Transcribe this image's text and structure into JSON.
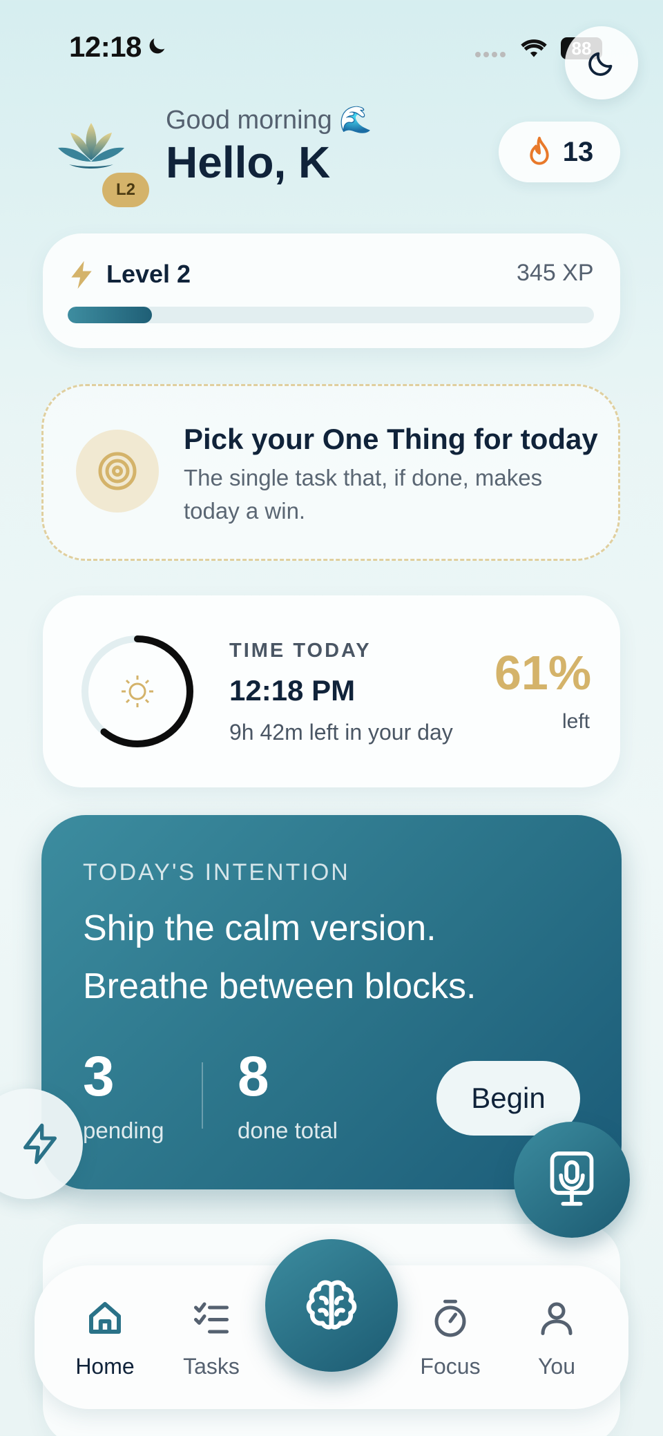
{
  "status_bar": {
    "time": "12:18",
    "battery": "88"
  },
  "header": {
    "greeting": "Good morning 🌊",
    "title": "Hello, K",
    "level_badge": "L2",
    "streak_count": "13"
  },
  "level_card": {
    "title": "Level 2",
    "xp": "345 XP",
    "progress_fraction": 0.16
  },
  "one_thing": {
    "title": "Pick your One Thing for today",
    "subtitle": "The single task that, if done, makes today a win."
  },
  "time_card": {
    "label": "TIME TODAY",
    "time": "12:18 PM",
    "remaining": "9h 42m left in your day",
    "percent": "61%",
    "percent_label": "left",
    "ring_fraction": 0.61
  },
  "intention": {
    "label": "TODAY'S INTENTION",
    "line1": "Ship the calm version.",
    "line2": "Breathe between blocks.",
    "pending_count": "3",
    "pending_label": "pending",
    "done_count": "8",
    "done_label": "done total",
    "begin_label": "Begin"
  },
  "tabs": [
    {
      "label": "Home",
      "icon": "home-icon",
      "active": true
    },
    {
      "label": "Tasks",
      "icon": "tasks-icon",
      "active": false
    },
    {
      "label": "Focus",
      "icon": "stopwatch-icon",
      "active": false
    },
    {
      "label": "You",
      "icon": "user-icon",
      "active": false
    }
  ],
  "colors": {
    "accent_teal": "#2a7288",
    "gold": "#d4b36a",
    "streak_flame": "#e8792a",
    "text_dark": "#10233a"
  }
}
